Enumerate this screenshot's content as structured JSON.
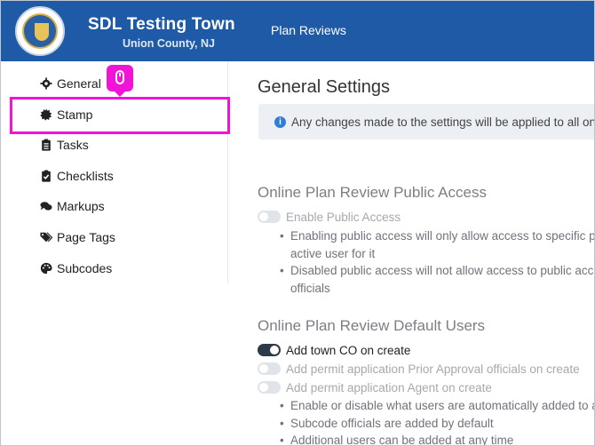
{
  "header": {
    "app_title": "SDL Testing Town",
    "app_subtitle": "Union County, NJ",
    "nav_link": "Plan Reviews",
    "brand_color": "#1f5aa6"
  },
  "sidebar": {
    "items": [
      {
        "label": "General",
        "icon": "gear-icon"
      },
      {
        "label": "Stamp",
        "icon": "stamp-icon"
      },
      {
        "label": "Tasks",
        "icon": "clipboard-list-icon"
      },
      {
        "label": "Checklists",
        "icon": "clipboard-check-icon"
      },
      {
        "label": "Markups",
        "icon": "comments-icon"
      },
      {
        "label": "Page Tags",
        "icon": "tags-icon"
      },
      {
        "label": "Subcodes",
        "icon": "palette-icon"
      }
    ],
    "highlight_color": "#f015d6"
  },
  "main": {
    "title": "General Settings",
    "info_text": "Any changes made to the settings will be applied to all onli",
    "public_access": {
      "title": "Online Plan Review Public Access",
      "toggle_label": "Enable Public Access",
      "toggle_state": "off",
      "bullets": [
        "Enabling public access will only allow access to specific pla",
        "active user for it",
        "Disabled public access will not allow access to public acco",
        "officials"
      ]
    },
    "default_users": {
      "title": "Online Plan Review Default Users",
      "toggles": [
        {
          "label": "Add town CO on create",
          "state": "on"
        },
        {
          "label": "Add permit application Prior Approval officials on create",
          "state": "off"
        },
        {
          "label": "Add permit application Agent on create",
          "state": "off"
        }
      ],
      "bullets": [
        "Enable or disable what users are automatically added to a",
        "Subcode officials are added by default",
        "Additional users can be added at any time"
      ]
    }
  }
}
